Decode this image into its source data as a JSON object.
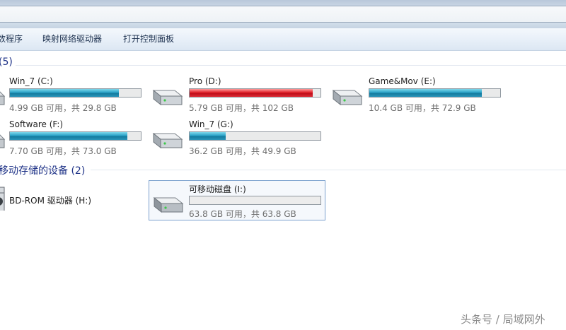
{
  "toolbar": {
    "items": [
      "数程序",
      "映射网络驱动器",
      "打开控制面板"
    ]
  },
  "groups": {
    "hard_disks": "(5)",
    "removable": "移动存储的设备 (2)"
  },
  "drives": [
    {
      "name": "Win_7 (C:)",
      "info": "4.99 GB 可用，共 29.8 GB",
      "used_fraction": 0.833,
      "bar_color": "#2aa1c7",
      "icon": "hard-drive-icon"
    },
    {
      "name": "Pro (D:)",
      "info": "5.79 GB 可用，共 102 GB",
      "used_fraction": 0.943,
      "bar_color": "#e0202a",
      "icon": "hard-drive-icon"
    },
    {
      "name": "Game&Mov (E:)",
      "info": "10.4 GB 可用，共 72.9 GB",
      "used_fraction": 0.857,
      "bar_color": "#2aa1c7",
      "icon": "hard-drive-icon"
    },
    {
      "name": "Software (F:)",
      "info": "7.70 GB 可用，共 73.0 GB",
      "used_fraction": 0.895,
      "bar_color": "#2aa1c7",
      "icon": "hard-drive-icon"
    },
    {
      "name": "Win_7 (G:)",
      "info": "36.2 GB 可用，共 49.9 GB",
      "used_fraction": 0.275,
      "bar_color": "#2aa1c7",
      "icon": "hard-drive-icon"
    }
  ],
  "removable": [
    {
      "name": "BD-ROM 驱动器 (H:)",
      "icon": "optical-drive-icon"
    },
    {
      "name": "可移动磁盘 (I:)",
      "info": "63.8 GB 可用，共 63.8 GB",
      "used_fraction": 0.0,
      "icon": "removable-disk-icon"
    }
  ],
  "watermark": "头条号 / 局域网外"
}
